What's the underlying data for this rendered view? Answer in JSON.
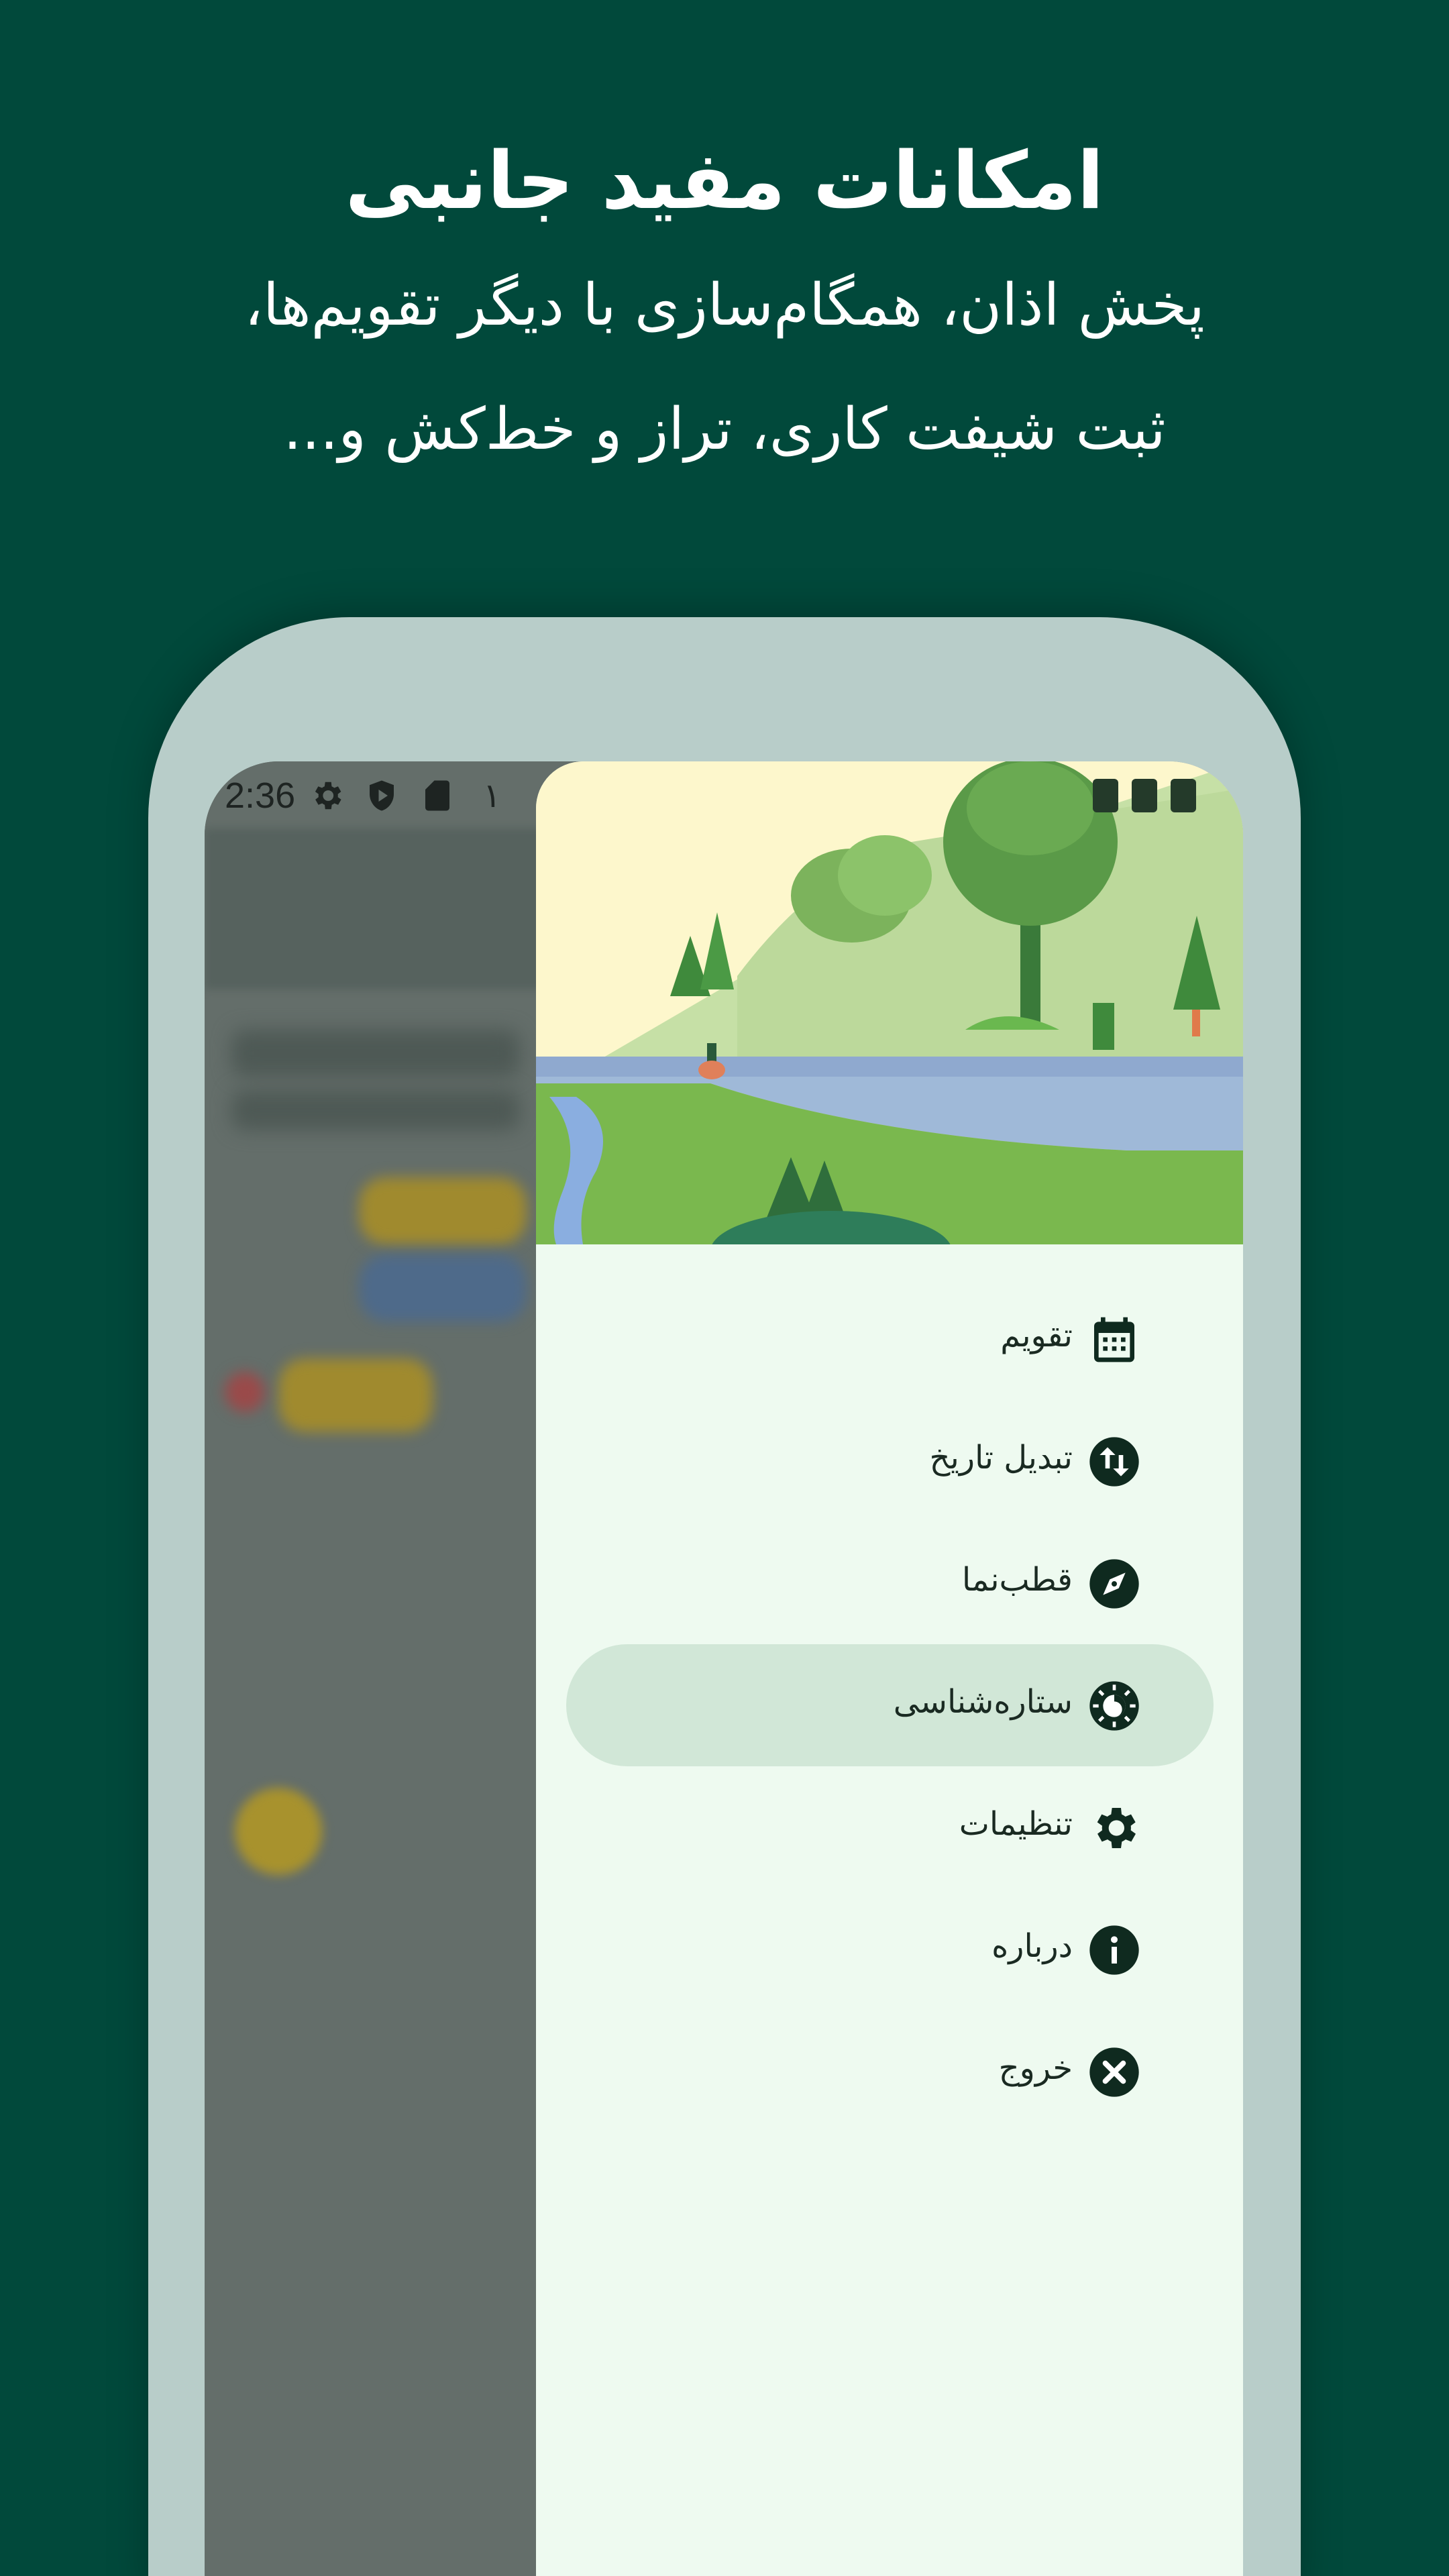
{
  "headline": "امکانات مفید جانبی",
  "subtitle_line1": "پخش اذان، همگام‌سازی با دیگر تقویم‌ها،",
  "subtitle_line2": "ثبت شیفت کاری، تراز و خط‌کش و...",
  "status_bar": {
    "time": "2:36",
    "digit": "۱",
    "icons": [
      "settings-icon",
      "shield-play-icon",
      "sd-card-icon",
      "wifi-icon",
      "signal-icon",
      "battery-icon"
    ]
  },
  "drawer": {
    "items": [
      {
        "label": "تقویم",
        "icon": "calendar-icon",
        "active": false
      },
      {
        "label": "تبدیل تاریخ",
        "icon": "convert-arrows-icon",
        "active": false
      },
      {
        "label": "قطب‌نما",
        "icon": "compass-icon",
        "active": false
      },
      {
        "label": "ستاره‌شناسی",
        "icon": "astronomy-icon",
        "active": true
      },
      {
        "label": "تنظیمات",
        "icon": "gear-icon",
        "active": false
      },
      {
        "label": "درباره",
        "icon": "info-icon",
        "active": false
      },
      {
        "label": "خروج",
        "icon": "close-circle-icon",
        "active": false
      }
    ]
  },
  "colors": {
    "background": "#01493b",
    "device_frame": "#b8cdc9",
    "drawer_bg": "#eefaf0",
    "active_item": "#d1e7d7",
    "icon": "#0f2a1f"
  }
}
